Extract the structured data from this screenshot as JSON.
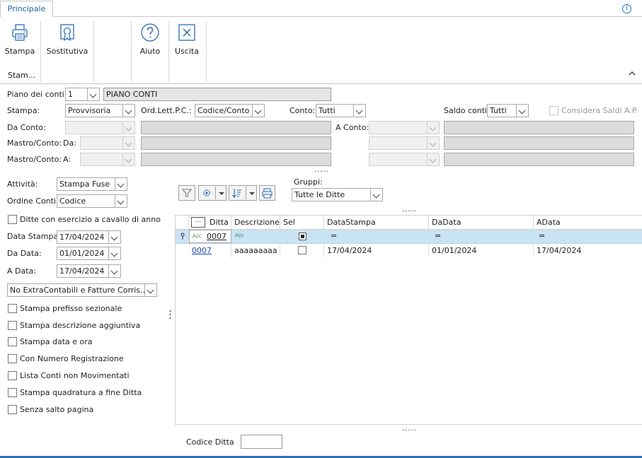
{
  "ribbon": {
    "tab_label": "Principale",
    "info_icon": "info-icon",
    "buttons": [
      {
        "label": "Stampa",
        "icon": "printer-icon"
      },
      {
        "label": "Sostitutiva",
        "icon": "certificate-icon"
      },
      {
        "label": "Aiuto",
        "icon": "help-icon"
      },
      {
        "label": "Uscita",
        "icon": "close-icon"
      }
    ],
    "group_label": "Stam...",
    "collapse_icon": "chevron-up-icon"
  },
  "form": {
    "piano_label": "Piano dei conti:",
    "piano_value": "1",
    "piano_desc": "PIANO CONTI",
    "stampa_label": "Stampa:",
    "stampa_value": "Provvisoria",
    "ord_label": "Ord.Lett.P.C.:",
    "ord_value": "Codice/Conto",
    "conto_label": "Conto:",
    "conto_value": "Tutti",
    "saldo_label": "Saldo conti:",
    "saldo_value": "Tutti",
    "considera_label": "Considera Saldi A.P.",
    "da_conto_label": "Da Conto:",
    "a_conto_label": "A Conto:",
    "mastro_da_label": "Mastro/Conto:",
    "mastro_da_sub": "Da:",
    "mastro_a_label": "Mastro/Conto:",
    "mastro_a_sub": "A:",
    "splitter_dots": "....."
  },
  "left": {
    "attivita_label": "Attività:",
    "attivita_value": "Stampa Fuse",
    "ordine_label": "Ordine Conti:",
    "ordine_value": "Codice",
    "cavallo_label": "Ditte con esercizio a cavallo di anno",
    "data_stampa_label": "Data Stampa:",
    "data_stampa_value": "17/04/2024",
    "da_data_label": "Da Data:",
    "da_data_value": "01/01/2024",
    "a_data_label": "A Data:",
    "a_data_value": "17/04/2024",
    "extra_value": "No ExtraContabili e Fatture Corris...",
    "options": [
      "Stampa prefisso sezionale",
      "Stampa descrizione aggiuntiva",
      "Stampa data e ora",
      "Con Numero Registrazione",
      "Lista Conti non Movimentati",
      "Stampa quadratura a fine Ditta",
      "Senza salto pagina"
    ]
  },
  "grid": {
    "gruppi_label": "Gruppi:",
    "gruppi_value": "Tutte le Ditte",
    "col_menu": "...",
    "columns": [
      "Ditta",
      "Descrizione",
      "Sel",
      "DataStampa",
      "DaData",
      "AData"
    ],
    "filter_ditta": "0007",
    "filter_eq": "=",
    "rows": [
      {
        "ditta": "0007",
        "descrizione": "aaaaaaaaa",
        "datastampa": "17/04/2024",
        "dadata": "01/01/2024",
        "adata": "17/04/2024"
      }
    ],
    "splitter_dots": "....."
  },
  "footer": {
    "codice_ditta_label": "Codice Ditta",
    "codice_ditta_value": ""
  },
  "colors": {
    "accent": "#1f5fa8",
    "filter_row": "#c9e2f4",
    "bottom_bar": "#2f6db5"
  }
}
